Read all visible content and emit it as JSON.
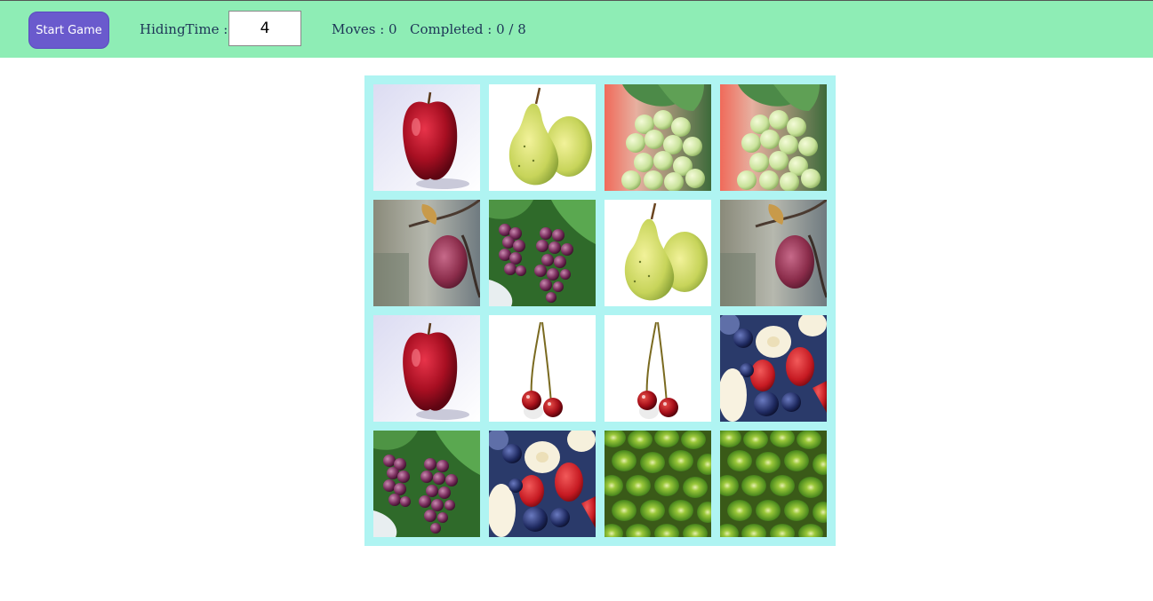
{
  "toolbar": {
    "start_label": "Start Game",
    "hiding_label": "HidingTime :",
    "hiding_value": "4",
    "moves_label": "Moves : 0",
    "completed_label": "Completed : 0 / 8"
  },
  "board": {
    "cards": [
      {
        "fruit": "red-apple"
      },
      {
        "fruit": "pear"
      },
      {
        "fruit": "green-grapes"
      },
      {
        "fruit": "green-grapes"
      },
      {
        "fruit": "apple-on-branch"
      },
      {
        "fruit": "purple-grapes"
      },
      {
        "fruit": "pear"
      },
      {
        "fruit": "apple-on-branch"
      },
      {
        "fruit": "red-apple"
      },
      {
        "fruit": "cherries"
      },
      {
        "fruit": "cherries"
      },
      {
        "fruit": "mixed-berries"
      },
      {
        "fruit": "purple-grapes"
      },
      {
        "fruit": "mixed-berries"
      },
      {
        "fruit": "kiwi"
      },
      {
        "fruit": "kiwi"
      }
    ]
  },
  "colors": {
    "toolbar_bg": "#8eedb5",
    "button_bg": "#6a5acd",
    "board_bg": "#aff4f2"
  }
}
